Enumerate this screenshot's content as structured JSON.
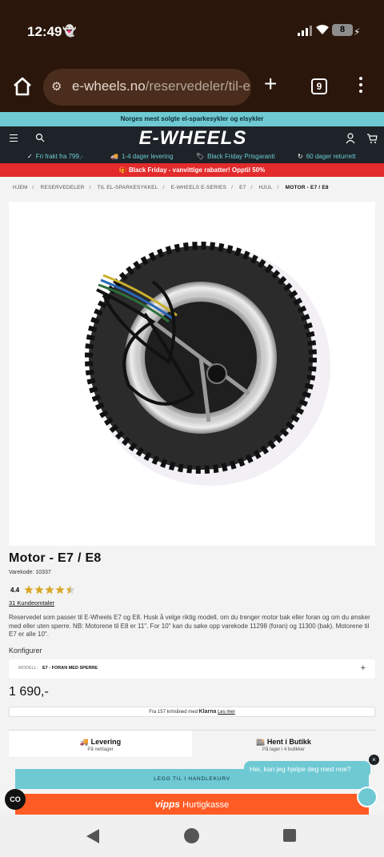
{
  "status": {
    "time": "12:49",
    "battery": "8"
  },
  "browser": {
    "url_host": "e-wheels.no",
    "url_path": "/reservedeler/til-el",
    "tab_count": "9"
  },
  "site": {
    "top_strip": "Norges mest solgte el-sparkesykler og elsykler",
    "logo": "E-WHEELS",
    "usps": [
      "Fri frakt fra 799,-",
      "1-4 dager levering",
      "Black Friday Prisgaranti",
      "60 dager returrett"
    ],
    "promo": "Black Friday - vanvittige rabatter! Opptil 50%"
  },
  "breadcrumb": [
    "HJEM",
    "RESERVEDELER",
    "TIL EL-SPARKESYKKEL",
    "E-WHEELS E-SERIES",
    "E7",
    "HJUL",
    "MOTOR - E7 / E8"
  ],
  "product": {
    "title": "Motor - E7 / E8",
    "sku": "Varekode: 10337",
    "rating_value": "4.4",
    "rating_fraction": 0.88,
    "reviews": "31 Kundeomtaler",
    "description": "Reservedel som passer til E-Wheels E7 og E8. Husk å velge riktig modell, om du trenger motor bak eller foran og om du ønsker med eller uten sperre. NB: Motorene til E8 er 11\". For 10\" kan du søke opp varekode 11298 (foran) og 11300 (bak). Motorene til E7 er alle 10\".",
    "configure_label": "Konfigurer",
    "model_label": "MODELL:",
    "model_value": "E7 - FORAN MED SPERRE",
    "price": "1 690,-",
    "klarna_prefix": "Fra 157 kr/måned med",
    "klarna_brand": "Klarna",
    "klarna_link": "Les mer"
  },
  "delivery_tabs": [
    {
      "title": "Levering",
      "subtitle": "På nettlager"
    },
    {
      "title": "Hent i Butikk",
      "subtitle": "På lager i 4 butikker"
    }
  ],
  "buttons": {
    "add_to_cart": "LEGG TIL I HANDLEKURV",
    "vipps_brand": "vipps",
    "vipps_label": "Hurtigkasse"
  },
  "chat": {
    "message": "Hei, kan jeg hjelpe deg med noe?",
    "close": "×",
    "badge": "CO"
  },
  "colors": {
    "accent": "#6ec9d3",
    "promo_red": "#e32a2c",
    "vipps_orange": "#ff5b24",
    "header_dark": "#1d2328"
  }
}
